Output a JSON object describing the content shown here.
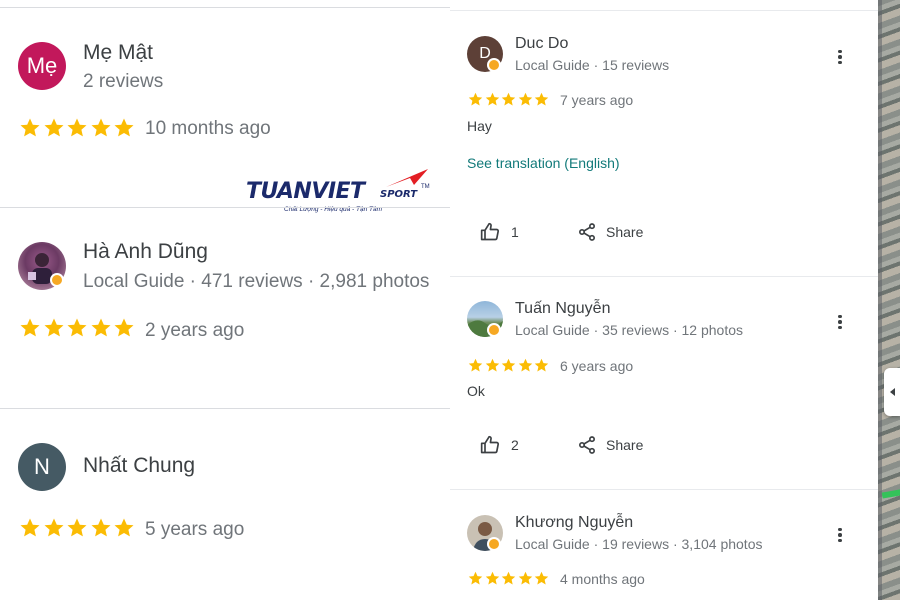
{
  "left_reviews": [
    {
      "initials": "Mẹ",
      "name": "Mẹ Mật",
      "meta": "2 reviews",
      "rating": 5,
      "time": "10 months ago",
      "avatar_color": "#c2185b"
    },
    {
      "name": "Hà Anh Dũng",
      "meta": "Local Guide · 471 reviews · 2,981 photos",
      "rating": 5,
      "time": "2 years ago"
    },
    {
      "initials": "N",
      "name": "Nhất Chung",
      "rating": 5,
      "time": "5 years ago",
      "avatar_color": "#455a64"
    }
  ],
  "logo": {
    "word": "TUANVIET",
    "sport": "SPORT",
    "tm": "TM",
    "tagline": "Chất Lượng - Hiệu quả - Tận Tâm"
  },
  "right_reviews": [
    {
      "initial": "D",
      "name": "Duc Do",
      "meta": "Local Guide · 15 reviews",
      "rating": 5,
      "time": "7 years ago",
      "text": "Hay",
      "translation_link": "See translation (English)",
      "likes": "1",
      "share_label": "Share",
      "avatar_color": "#5d4037"
    },
    {
      "name": "Tuấn Nguyễn",
      "meta": "Local Guide · 35 reviews · 12 photos",
      "rating": 5,
      "time": "6 years ago",
      "text": "Ok",
      "likes": "2",
      "share_label": "Share"
    },
    {
      "name": "Khương Nguyễn",
      "meta": "Local Guide · 19 reviews · 3,104 photos",
      "rating": 5,
      "time": "4 months ago"
    }
  ],
  "colors": {
    "star": "#fbbc04",
    "guide_badge": "#f6a823",
    "link": "#127a7a",
    "brand_navy": "#1b2a6b",
    "brand_red": "#e31e24"
  },
  "icons": [
    "star-icon",
    "thumbs-up-icon",
    "share-icon",
    "more-vert-icon",
    "local-guide-badge-icon",
    "collapse-arrow-icon"
  ]
}
